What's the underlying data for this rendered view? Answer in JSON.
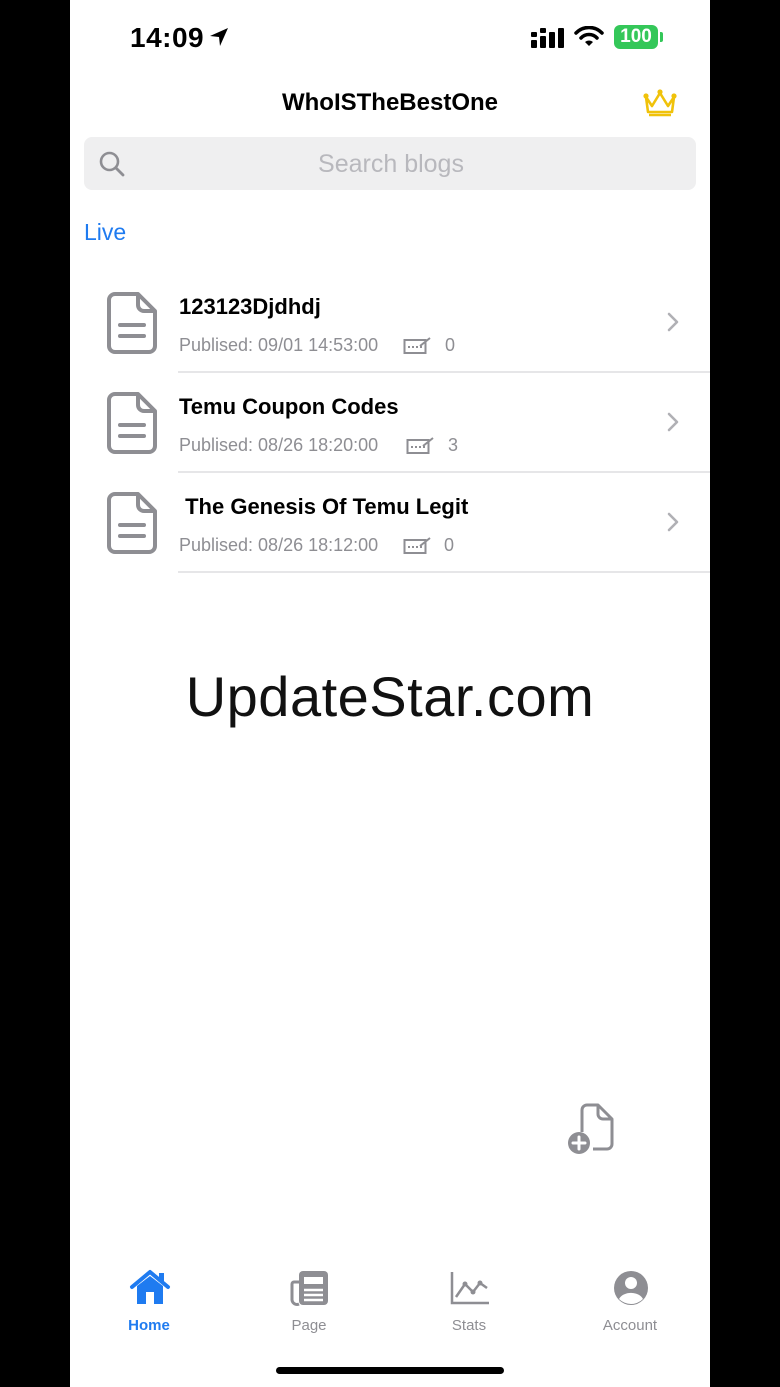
{
  "status_bar": {
    "time": "14:09",
    "battery": "100",
    "battery_color": "#34c759"
  },
  "header": {
    "title": "WhoISTheBestOne",
    "premium_icon": "crown-icon"
  },
  "search": {
    "placeholder": "Search blogs",
    "value": ""
  },
  "section": {
    "label": "Live",
    "accent": "#1f7bf0"
  },
  "posts": [
    {
      "title": "123123Djdhdj",
      "published": "Publised: 09/01 14:53:00",
      "comments": "0"
    },
    {
      "title": "Temu Coupon Codes",
      "published": "Publised: 08/26 18:20:00",
      "comments": "3"
    },
    {
      "title": " The Genesis Of Temu Legit",
      "published": "Publised: 08/26 18:12:00",
      "comments": "0"
    }
  ],
  "watermark": "UpdateStar.com",
  "fab": {
    "icon": "new-page-icon"
  },
  "tabs": [
    {
      "label": "Home",
      "icon": "home-icon",
      "active": true
    },
    {
      "label": "Page",
      "icon": "newspaper-icon",
      "active": false
    },
    {
      "label": "Stats",
      "icon": "chart-icon",
      "active": false
    },
    {
      "label": "Account",
      "icon": "account-icon",
      "active": false
    }
  ]
}
